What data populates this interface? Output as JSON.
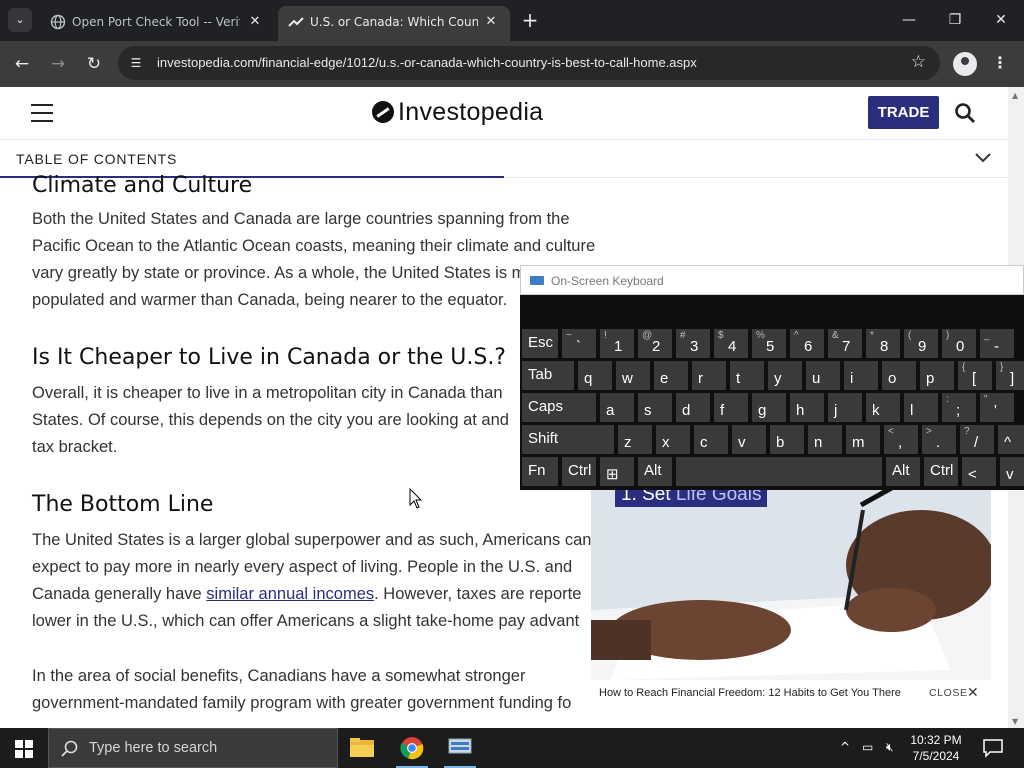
{
  "browser": {
    "tabs": [
      {
        "title": "Open Port Check Tool -- Verify",
        "active": false
      },
      {
        "title": "U.S. or Canada: Which Country",
        "active": true
      }
    ],
    "new_tab": "+",
    "url": "investopedia.com/financial-edge/1012/u.s.-or-canada-which-country-is-best-to-call-home.aspx",
    "window_controls": {
      "minimize": "—",
      "maximize": "❐",
      "close": "✕"
    }
  },
  "site": {
    "logo": "Investopedia",
    "trade_label": "TRADE",
    "toc_label": "TABLE OF CONTENTS",
    "toc_progress": 0.5
  },
  "article": {
    "section1": {
      "heading": "Climate and Culture",
      "lines": [
        "Both the United States and Canada are large countries spanning from the",
        "Pacific Ocean to the Atlantic Ocean coasts, meaning their climate and culture",
        "vary greatly by state or province. As a whole, the United States is m",
        "populated and warmer than Canada, being nearer to the equator."
      ]
    },
    "section2": {
      "heading": "Is It Cheaper to Live in Canada or the U.S.?",
      "lines": [
        "Overall, it is cheaper to live in a metropolitan city in Canada than",
        "States. Of course, this depends on the city you are looking at and",
        "tax bracket."
      ]
    },
    "section3": {
      "heading": "The Bottom Line",
      "line1": "The United States is a larger global superpower and as such, Americans can",
      "line2": "expect to pay more in nearly every aspect of living. People in the U.S. and",
      "line3_before": "Canada generally have ",
      "line3_link": "similar annual incomes",
      "line3_after": ". However, taxes are reporte",
      "line4": "lower in the U.S., which can offer Americans a slight take-home pay advant"
    },
    "section4": {
      "lines": [
        "In the area of social benefits, Canadians have a somewhat stronger",
        "government-mandated family program with greater government funding fo"
      ]
    }
  },
  "ad": {
    "overlay_prefix": "1. Set ",
    "overlay_highlight": "Life Goals",
    "caption": "How to Reach Financial Freedom: 12 Habits to Get You There",
    "close_label": "CLOSE",
    "close_icon": "✕"
  },
  "osk": {
    "title": "On-Screen Keyboard",
    "rows": [
      [
        {
          "main": "Esc",
          "shift": ""
        },
        {
          "main": "`",
          "shift": "~"
        },
        {
          "main": "1",
          "shift": "!"
        },
        {
          "main": "2",
          "shift": "@"
        },
        {
          "main": "3",
          "shift": "#"
        },
        {
          "main": "4",
          "shift": "$"
        },
        {
          "main": "5",
          "shift": "%"
        },
        {
          "main": "6",
          "shift": "^"
        },
        {
          "main": "7",
          "shift": "&"
        },
        {
          "main": "8",
          "shift": "*"
        },
        {
          "main": "9",
          "shift": "("
        },
        {
          "main": "0",
          "shift": ")"
        },
        {
          "main": "-",
          "shift": "_"
        }
      ],
      [
        {
          "main": "Tab",
          "shift": ""
        },
        {
          "main": "q",
          "shift": ""
        },
        {
          "main": "w",
          "shift": ""
        },
        {
          "main": "e",
          "shift": ""
        },
        {
          "main": "r",
          "shift": ""
        },
        {
          "main": "t",
          "shift": ""
        },
        {
          "main": "y",
          "shift": ""
        },
        {
          "main": "u",
          "shift": ""
        },
        {
          "main": "i",
          "shift": ""
        },
        {
          "main": "o",
          "shift": ""
        },
        {
          "main": "p",
          "shift": ""
        },
        {
          "main": "[",
          "shift": "{"
        },
        {
          "main": "]",
          "shift": "}"
        }
      ],
      [
        {
          "main": "Caps",
          "shift": ""
        },
        {
          "main": "a",
          "shift": ""
        },
        {
          "main": "s",
          "shift": ""
        },
        {
          "main": "d",
          "shift": ""
        },
        {
          "main": "f",
          "shift": ""
        },
        {
          "main": "g",
          "shift": ""
        },
        {
          "main": "h",
          "shift": ""
        },
        {
          "main": "j",
          "shift": ""
        },
        {
          "main": "k",
          "shift": ""
        },
        {
          "main": "l",
          "shift": ""
        },
        {
          "main": ";",
          "shift": ":"
        },
        {
          "main": "'",
          "shift": "\""
        }
      ],
      [
        {
          "main": "Shift",
          "shift": ""
        },
        {
          "main": "z",
          "shift": ""
        },
        {
          "main": "x",
          "shift": ""
        },
        {
          "main": "c",
          "shift": ""
        },
        {
          "main": "v",
          "shift": ""
        },
        {
          "main": "b",
          "shift": ""
        },
        {
          "main": "n",
          "shift": ""
        },
        {
          "main": "m",
          "shift": ""
        },
        {
          "main": ",",
          "shift": "<"
        },
        {
          "main": ".",
          "shift": ">"
        },
        {
          "main": "/",
          "shift": "?"
        },
        {
          "main": "^",
          "shift": ""
        }
      ],
      [
        {
          "main": "Fn",
          "shift": ""
        },
        {
          "main": "Ctrl",
          "shift": ""
        },
        {
          "main": "⊞",
          "shift": ""
        },
        {
          "main": "Alt",
          "shift": ""
        },
        {
          "main": "",
          "shift": ""
        },
        {
          "main": "Alt",
          "shift": ""
        },
        {
          "main": "Ctrl",
          "shift": ""
        },
        {
          "main": "<",
          "shift": ""
        },
        {
          "main": "v",
          "shift": ""
        }
      ]
    ]
  },
  "taskbar": {
    "search_placeholder": "Type here to search",
    "time": "10:32 PM",
    "date": "7/5/2024"
  }
}
